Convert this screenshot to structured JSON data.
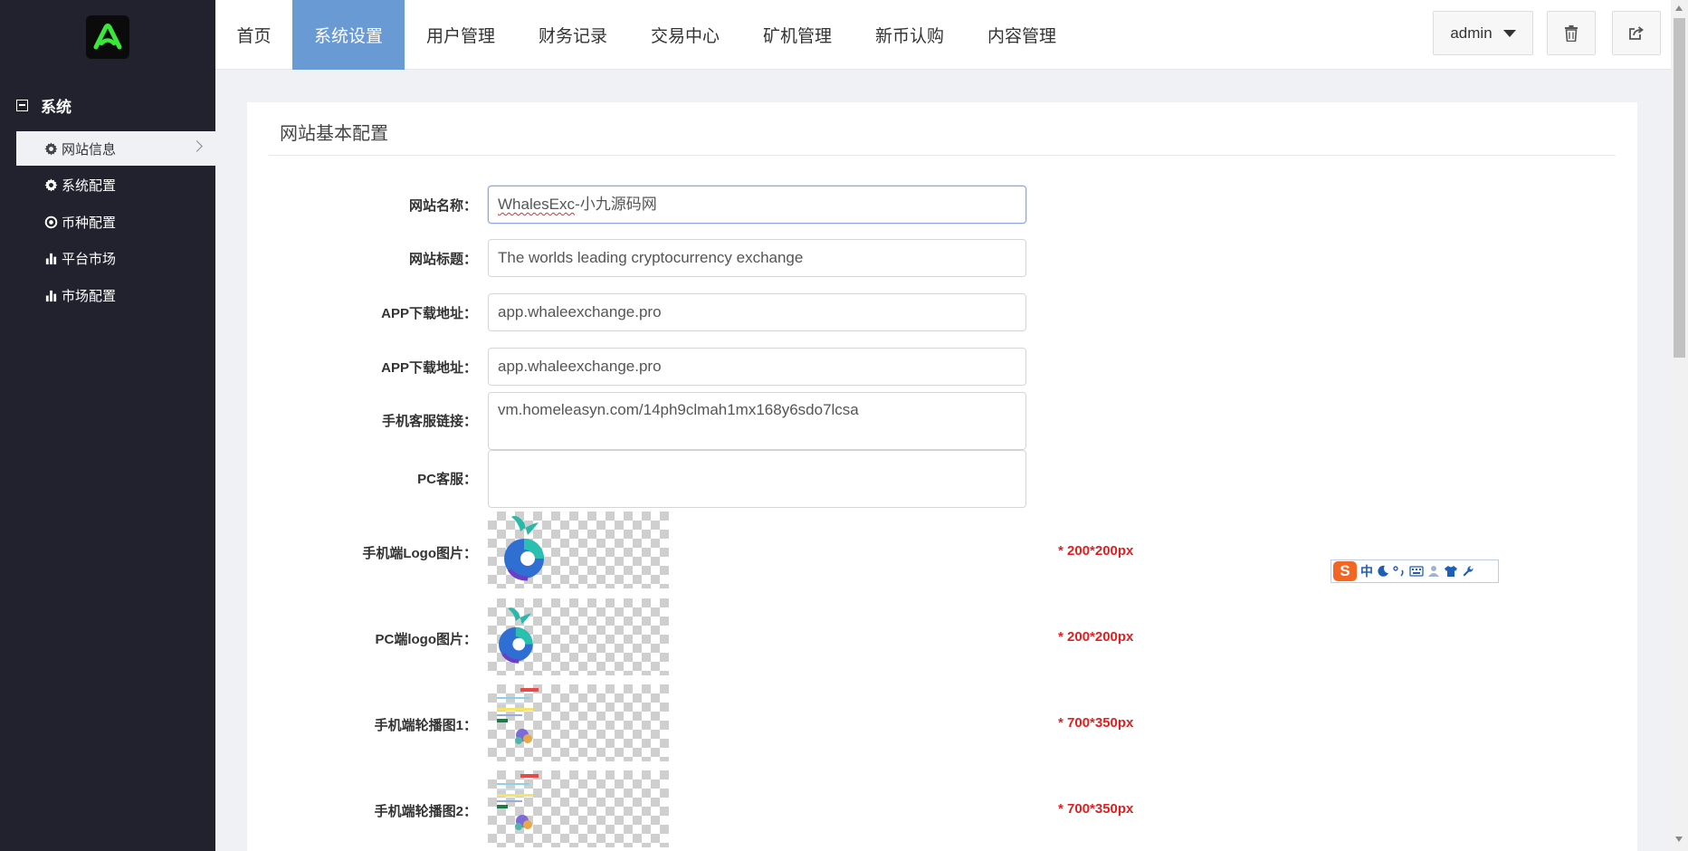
{
  "sidebar": {
    "section_title": "系统",
    "items": [
      {
        "label": "网站信息",
        "icon": "gear-icon"
      },
      {
        "label": "系统配置",
        "icon": "gear-icon"
      },
      {
        "label": "币种配置",
        "icon": "circle-dot-icon"
      },
      {
        "label": "平台市场",
        "icon": "bar-chart-icon"
      },
      {
        "label": "市场配置",
        "icon": "bar-chart-icon"
      }
    ]
  },
  "topnav": {
    "tabs": [
      {
        "label": "首页"
      },
      {
        "label": "系统设置"
      },
      {
        "label": "用户管理"
      },
      {
        "label": "财务记录"
      },
      {
        "label": "交易中心"
      },
      {
        "label": "矿机管理"
      },
      {
        "label": "新币认购"
      },
      {
        "label": "内容管理"
      }
    ],
    "active_tab": "系统设置",
    "user_label": "admin"
  },
  "panel": {
    "title": "网站基本配置",
    "fields": [
      {
        "label": "网站名称：",
        "value_part1": "WhalesExc",
        "value_part2": "-小九源码网"
      },
      {
        "label": "网站标题：",
        "value": "The worlds leading cryptocurrency exchange"
      },
      {
        "label": "APP下载地址：",
        "value": "app.whaleexchange.pro"
      },
      {
        "label": "APP下载地址：",
        "value": "app.whaleexchange.pro"
      },
      {
        "label": "手机客服链接：",
        "value": "vm.homeleasyn.com/14ph9clmah1mx168y6sdo7lcsa"
      },
      {
        "label": "PC客服：",
        "value": ""
      }
    ],
    "images": [
      {
        "label": "手机端Logo图片：",
        "hint": "* 200*200px"
      },
      {
        "label": "PC端logo图片：",
        "hint": "* 200*200px"
      },
      {
        "label": "手机端轮播图1：",
        "hint": "* 700*350px"
      },
      {
        "label": "手机端轮播图2：",
        "hint": "* 700*350px"
      }
    ]
  },
  "ime_toolbar": {
    "mode": "中"
  },
  "colors": {
    "sidebar_bg": "#22222e",
    "active_tab": "#6a9ad4",
    "hint_red": "#e02020",
    "page_bg": "#f0f1f5"
  }
}
